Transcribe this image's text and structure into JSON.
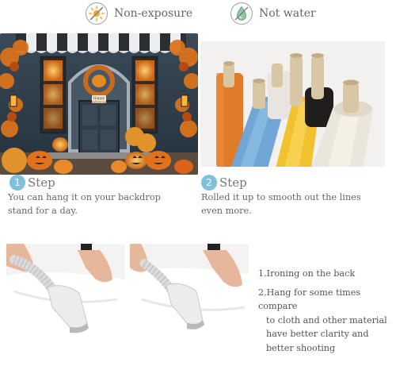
{
  "badges": [
    {
      "icon": "sun-icon",
      "label": "Non-exposure"
    },
    {
      "icon": "water-drop-icon",
      "label": "Not water"
    }
  ],
  "steps": [
    {
      "number": "1",
      "label": "Step",
      "lines": [
        "You can hang it on your backdrop",
        "stand for a day."
      ]
    },
    {
      "number": "2",
      "label": "Step",
      "lines": [
        "Rolled it up to smooth out the lines",
        "even more."
      ]
    }
  ],
  "store_sign": {
    "line1": "Happy",
    "line2": "Halloween"
  },
  "notes": [
    {
      "lines": [
        "1.Ironing on the back"
      ]
    },
    {
      "lines": [
        "2.Hang for some times compare",
        "to cloth and other material",
        "have better clarity and",
        "better shooting"
      ]
    }
  ]
}
